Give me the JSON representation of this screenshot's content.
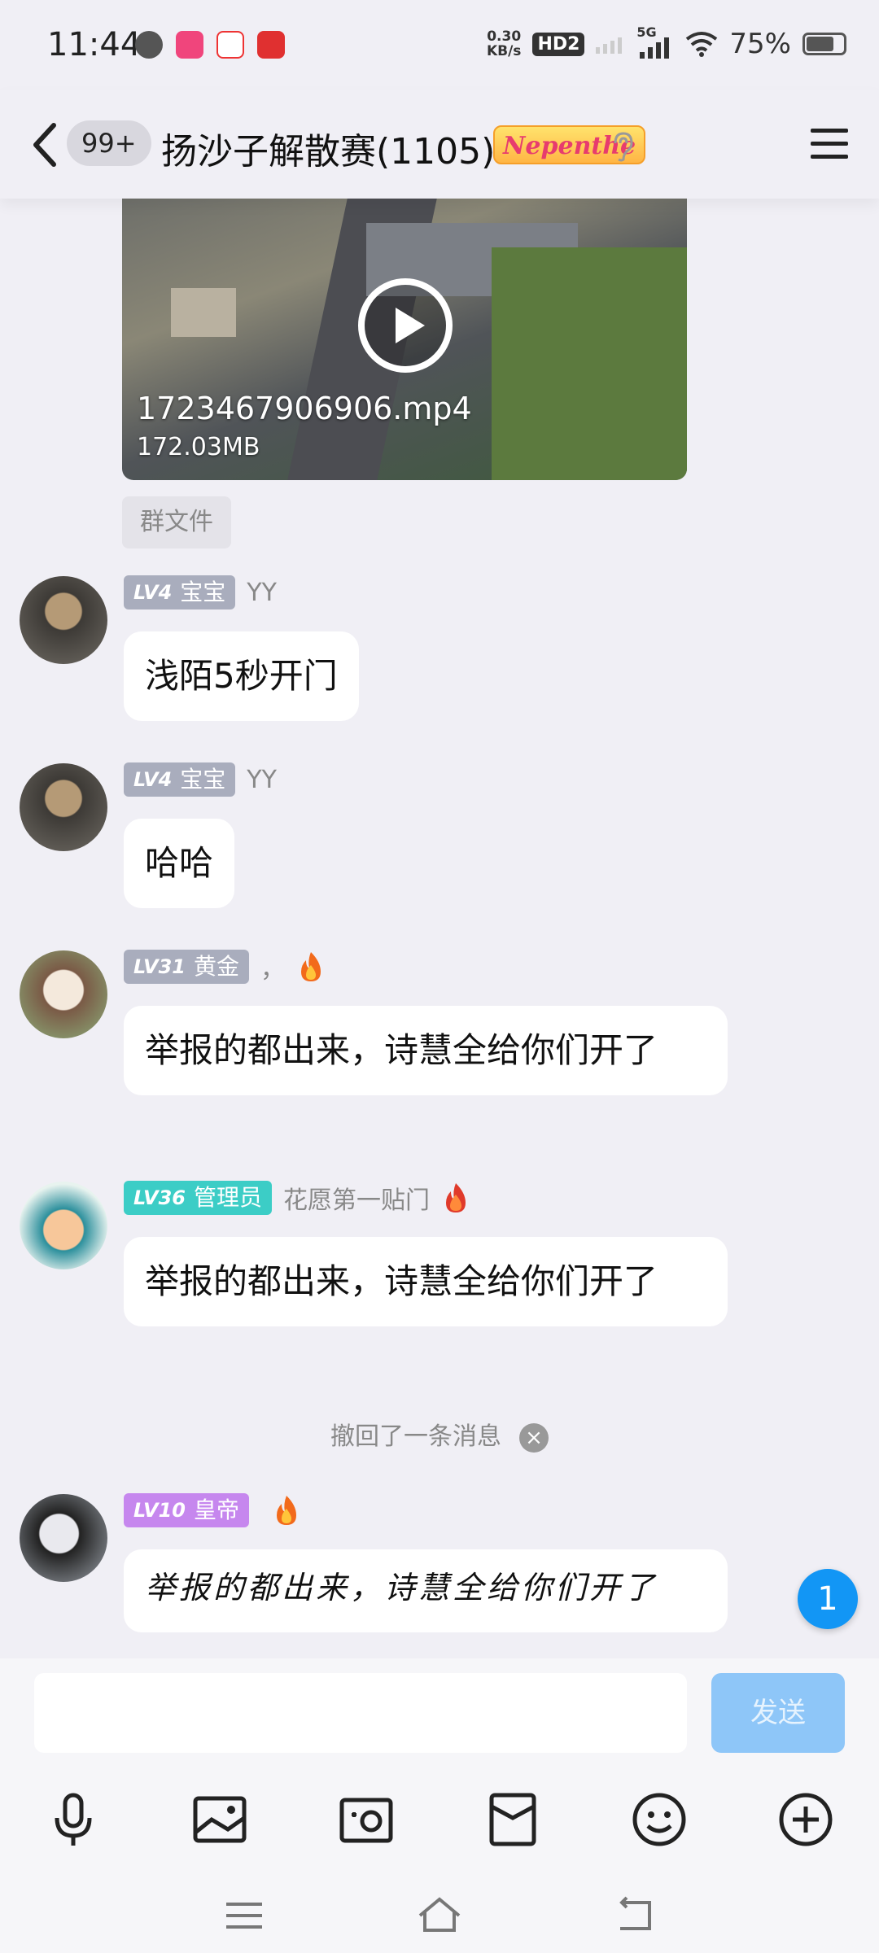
{
  "status": {
    "time": "11:44",
    "speed_top": "0.30",
    "speed_unit": "KB/s",
    "hd": "HD2",
    "network": "5G",
    "battery": "75%",
    "battery_level": 0.75
  },
  "header": {
    "unread_count": "99+",
    "title": "扬沙子解散赛(1105)",
    "badge_text": "Nepenthe"
  },
  "video": {
    "file_name": "1723467906906.mp4",
    "file_size": "172.03MB",
    "tag": "群文件"
  },
  "messages": [
    {
      "level": "LV4",
      "title": "宝宝",
      "nick": "YY",
      "text": "浅陌5秒开门"
    },
    {
      "level": "LV4",
      "title": "宝宝",
      "nick": "YY",
      "text": "哈哈"
    },
    {
      "level": "LV31",
      "title": "黄金",
      "nick": "，",
      "text": "举报的都出来，诗慧全给你们开了"
    },
    {
      "level": "LV36",
      "title": "管理员",
      "nick": "花愿第一贴门",
      "text": "举报的都出来，诗慧全给你们开了"
    },
    {
      "level": "LV10",
      "title": "皇帝",
      "nick": "",
      "text": "举报的都出来，诗慧全给你们开了"
    }
  ],
  "recall_notice": "撤回了一条消息",
  "unread_bubble": "1",
  "input": {
    "placeholder": "",
    "send_label": "发送"
  },
  "colors": {
    "accent": "#1296f5",
    "send_disabled": "#8ec6f8"
  }
}
